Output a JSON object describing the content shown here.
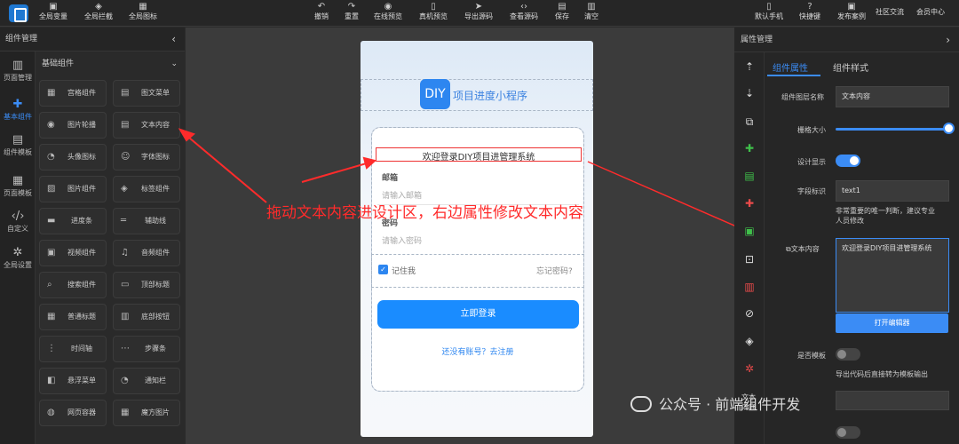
{
  "toolbar": {
    "left": [
      {
        "icon": "global-variable-icon",
        "label": "全局变量"
      },
      {
        "icon": "global-interceptor-icon",
        "label": "全局拦截"
      },
      {
        "icon": "global-icon-icon",
        "label": "全局图标"
      }
    ],
    "center": [
      {
        "icon": "undo-icon",
        "label": "撤销"
      },
      {
        "icon": "redo-icon",
        "label": "重置"
      },
      {
        "icon": "online-preview-icon",
        "label": "在线预览"
      },
      {
        "icon": "device-preview-icon",
        "label": "真机预览"
      },
      {
        "icon": "export-code-icon",
        "label": "导出源码"
      },
      {
        "icon": "view-code-icon",
        "label": "查看源码"
      },
      {
        "icon": "save-icon",
        "label": "保存"
      },
      {
        "icon": "clear-icon",
        "label": "清空"
      }
    ],
    "right": [
      {
        "icon": "phone-icon",
        "label": "默认手机"
      },
      {
        "icon": "help-icon",
        "label": "快捷键"
      },
      {
        "icon": "publish-icon",
        "label": "发布案例"
      },
      {
        "icon": "",
        "label": "社区交流"
      },
      {
        "icon": "",
        "label": "会员中心"
      }
    ]
  },
  "left_panel": {
    "title": "组件管理",
    "rail": [
      {
        "icon": "layout-icon",
        "label": "页面管理"
      },
      {
        "icon": "puzzle-icon",
        "label": "基本组件"
      },
      {
        "icon": "template-icon",
        "label": "组件模板"
      },
      {
        "icon": "page-template-icon",
        "label": "页面模板"
      },
      {
        "icon": "code-icon",
        "label": "自定义"
      },
      {
        "icon": "settings-icon",
        "label": "全局设置"
      }
    ],
    "group_title": "基础组件",
    "components": [
      {
        "label": "宫格组件",
        "icon": "grid-icon"
      },
      {
        "label": "图文菜单",
        "icon": "image-menu-icon"
      },
      {
        "label": "图片轮播",
        "icon": "carousel-icon"
      },
      {
        "label": "文本内容",
        "icon": "text-icon"
      },
      {
        "label": "头像图标",
        "icon": "avatar-icon"
      },
      {
        "label": "字体图标",
        "icon": "font-icon"
      },
      {
        "label": "图片组件",
        "icon": "image-icon"
      },
      {
        "label": "标签组件",
        "icon": "tag-icon"
      },
      {
        "label": "进度条",
        "icon": "progress-icon"
      },
      {
        "label": "辅助线",
        "icon": "divider-icon"
      },
      {
        "label": "视频组件",
        "icon": "video-icon"
      },
      {
        "label": "音频组件",
        "icon": "audio-icon"
      },
      {
        "label": "搜索组件",
        "icon": "search-icon"
      },
      {
        "label": "顶部标题",
        "icon": "header-icon"
      },
      {
        "label": "普通标题",
        "icon": "title-icon"
      },
      {
        "label": "底部按钮",
        "icon": "bottom-button-icon"
      },
      {
        "label": "时间轴",
        "icon": "timeline-icon"
      },
      {
        "label": "步骤条",
        "icon": "steps-icon"
      },
      {
        "label": "悬浮菜单",
        "icon": "float-menu-icon"
      },
      {
        "label": "通知栏",
        "icon": "notice-icon"
      },
      {
        "label": "网页容器",
        "icon": "webview-icon"
      },
      {
        "label": "魔方图片",
        "icon": "cube-image-icon"
      }
    ]
  },
  "phone": {
    "logo_text": "DIY",
    "app_title": "项目进度小程序",
    "welcome": "欢迎登录DIY项目进管理系统",
    "email_label": "邮箱",
    "email_placeholder": "请输入邮箱",
    "password_label": "密码",
    "password_placeholder": "请输入密码",
    "remember_me": "记住我",
    "forgot_password": "忘记密码?",
    "login_button": "立即登录",
    "register_link": "还没有账号？去注册"
  },
  "annotation": "拖动文本内容进设计区，右边属性修改文本内容",
  "right_panel": {
    "title": "属性管理",
    "tabs": [
      "组件属性",
      "组件样式"
    ],
    "active_tab": 0,
    "tools": [
      "arrow-up-icon",
      "arrow-down-icon",
      "copy-icon",
      "puzzle-green-icon",
      "document-green-icon",
      "puzzle-red-icon",
      "export-green-icon",
      "unlock-icon",
      "delete-icon",
      "link-icon",
      "layers-icon",
      "settings-red-icon"
    ],
    "tool_bottom_label_1": "文本",
    "tool_bottom_label_2": "内容",
    "props": {
      "layer_name_label": "组件图层名称",
      "layer_name_value": "文本内容",
      "grid_size_label": "栅格大小",
      "grid_size_value": 1.0,
      "design_display_label": "设计显示",
      "field_id_label": "字段标识",
      "field_id_value": "text1",
      "field_id_hint_1": "非常重要的唯一判断，建议专业",
      "field_id_hint_2": "人员修改",
      "text_content_label": "文本内容",
      "text_content_value": "欢迎登录DIY项目进管理系统",
      "open_editor": "打开编辑器",
      "is_template_label": "是否模板",
      "is_template_hint": "导出代码后直接转为模板输出"
    }
  },
  "watermark": "公众号 · 前端组件开发",
  "colors": {
    "accent": "#3b8cf5",
    "annotation": "#ff2b2b",
    "login": "#1a8cff"
  }
}
